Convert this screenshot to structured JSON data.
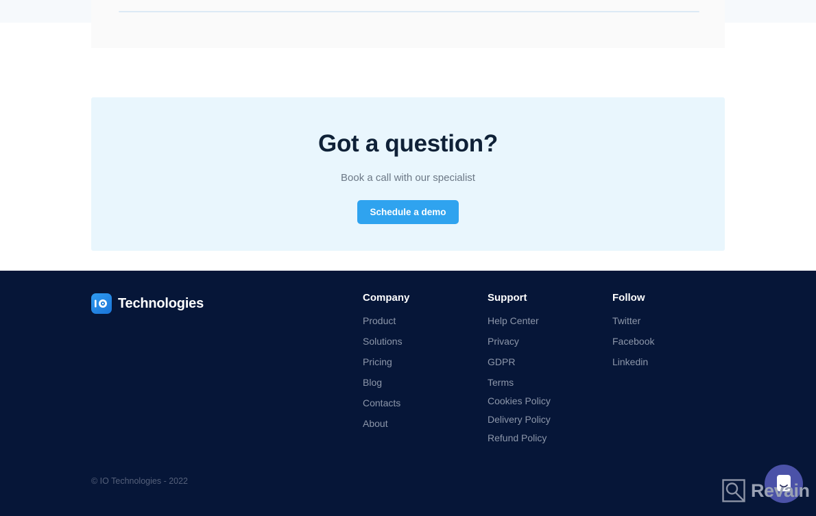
{
  "cta": {
    "title": "Got a question?",
    "subtitle": "Book a call with our specialist",
    "button_label": "Schedule a demo",
    "background_color": "#e9f6fd",
    "button_color": "#2fa3ef",
    "title_color": "#0f2137"
  },
  "footer": {
    "background_color": "#061638",
    "brand": {
      "mark_text": "IO",
      "name": "Technologies"
    },
    "columns": [
      {
        "heading": "Company",
        "links": [
          "Product",
          "Solutions",
          "Pricing",
          "Blog",
          "Contacts",
          "About"
        ]
      },
      {
        "heading": "Support",
        "links": [
          "Help Center",
          "Privacy",
          "GDPR",
          "Terms",
          "Cookies Policy",
          "Delivery Policy",
          "Refund Policy"
        ]
      },
      {
        "heading": "Follow",
        "links": [
          "Twitter",
          "Facebook",
          "Linkedin"
        ]
      }
    ],
    "copyright": "© IO Technologies - 2022",
    "link_color": "#8d97aa"
  },
  "widgets": {
    "chat_launcher": {
      "icon": "chat-bubble-smile-icon",
      "color": "#4b52a8"
    },
    "watermark": {
      "icon": "revain-magnifier-square-icon",
      "text": "Revain"
    }
  }
}
